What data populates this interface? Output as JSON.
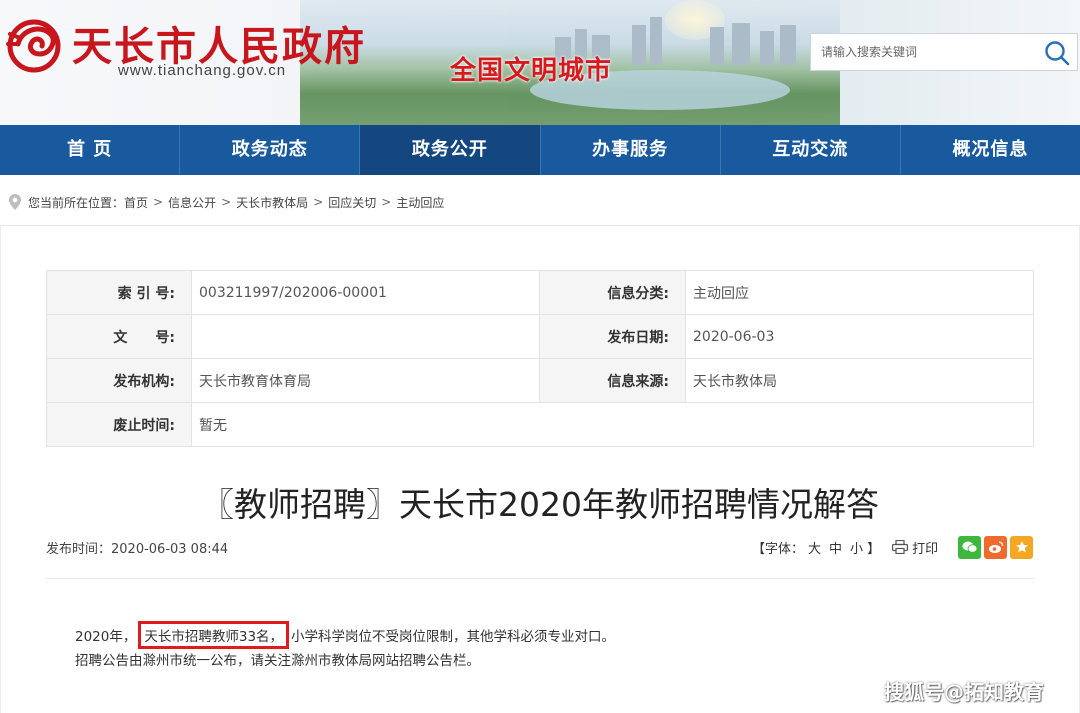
{
  "header": {
    "site_title": "天长市人民政府",
    "site_url": "www.tianchang.gov.cn",
    "slogan": "全国文明城市",
    "search_placeholder": "请输入搜索关键词",
    "brand_color": "#c8161d"
  },
  "nav": {
    "items": [
      {
        "label": "首 页"
      },
      {
        "label": "政务动态"
      },
      {
        "label": "政务公开"
      },
      {
        "label": "办事服务"
      },
      {
        "label": "互动交流"
      },
      {
        "label": "概况信息"
      }
    ],
    "active_index": 2,
    "color": "#195a9e"
  },
  "breadcrumb": {
    "prefix": "您当前所在位置：",
    "items": [
      "首页",
      "信息公开",
      "天长市教体局",
      "回应关切",
      "主动回应"
    ],
    "separator": ">"
  },
  "info_table": {
    "rows": [
      {
        "k1": "索 引 号:",
        "v1": "003211997/202006-00001",
        "k2": "信息分类:",
        "v2": "主动回应"
      },
      {
        "k1": "文　　号:",
        "v1": "",
        "k2": "发布日期:",
        "v2": "2020-06-03"
      },
      {
        "k1": "发布机构:",
        "v1": "天长市教育体育局",
        "k2": "信息来源:",
        "v2": "天长市教体局"
      },
      {
        "k1": "废止时间:",
        "v1": "暂无"
      }
    ]
  },
  "article": {
    "title": "〖教师招聘〗天长市2020年教师招聘情况解答",
    "publish_time": "发布时间：2020-06-03 08:44",
    "font_label": "【字体：",
    "font_sizes": [
      "大",
      "中",
      "小"
    ],
    "font_close": "】",
    "print_label": "打印",
    "share_icons": [
      "wechat-icon",
      "weibo-icon",
      "qzone-icon"
    ],
    "p1_before": "2020年，",
    "p1_highlight": "天长市招聘教师33名，",
    "p1_after": "小学科学岗位不受岗位限制，其他学科必须专业对口。",
    "p2": "招聘公告由滁州市统一公布，请关注滁州市教体局网站招聘公告栏。"
  },
  "watermark": "搜狐号@拓知教育"
}
